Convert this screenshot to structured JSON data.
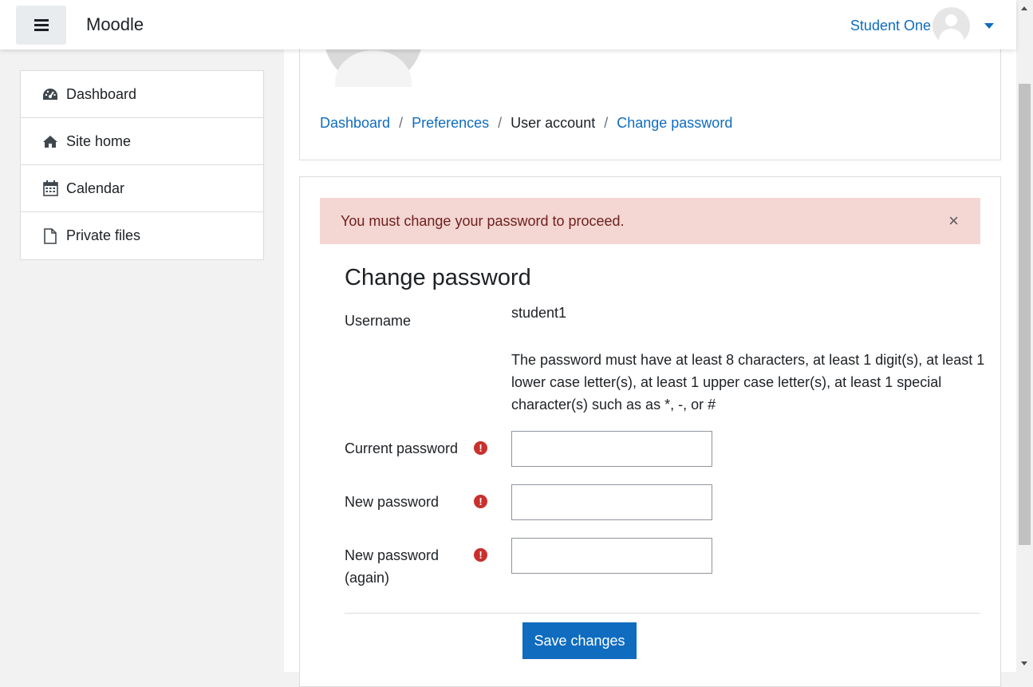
{
  "navbar": {
    "brand": "Moodle",
    "user_name": "Student One",
    "menu_icon": "hamburger-icon"
  },
  "drawer": {
    "items": [
      {
        "label": "Dashboard",
        "icon": "tachometer-icon"
      },
      {
        "label": "Site home",
        "icon": "home-icon"
      },
      {
        "label": "Calendar",
        "icon": "calendar-icon"
      },
      {
        "label": "Private files",
        "icon": "file-icon"
      }
    ]
  },
  "breadcrumb": {
    "items": [
      "Dashboard",
      "Preferences",
      "User account",
      "Change password"
    ],
    "separator": "/"
  },
  "alert": {
    "message": "You must change your password to proceed.",
    "close": "×"
  },
  "form": {
    "title": "Change password",
    "username_label": "Username",
    "username_value": "student1",
    "policy": "The password must have at least 8 characters, at least 1 digit(s), at least 1 lower case letter(s), at least 1 upper case letter(s), at least 1 special character(s) such as as *, -, or #",
    "current_password_label": "Current password",
    "new_password_label": "New password",
    "new_password_again_label_line1": "New password",
    "new_password_again_label_line2": "(again)",
    "required_marker": "!",
    "current_password_value": "",
    "new_password_value": "",
    "new_password_again_value": "",
    "save_label": "Save changes"
  },
  "colors": {
    "link": "#0f6cbf",
    "alert_bg": "#f4d6d3",
    "alert_text": "#6e211e",
    "required": "#c9302c",
    "primary_button": "#0f6cbf"
  }
}
